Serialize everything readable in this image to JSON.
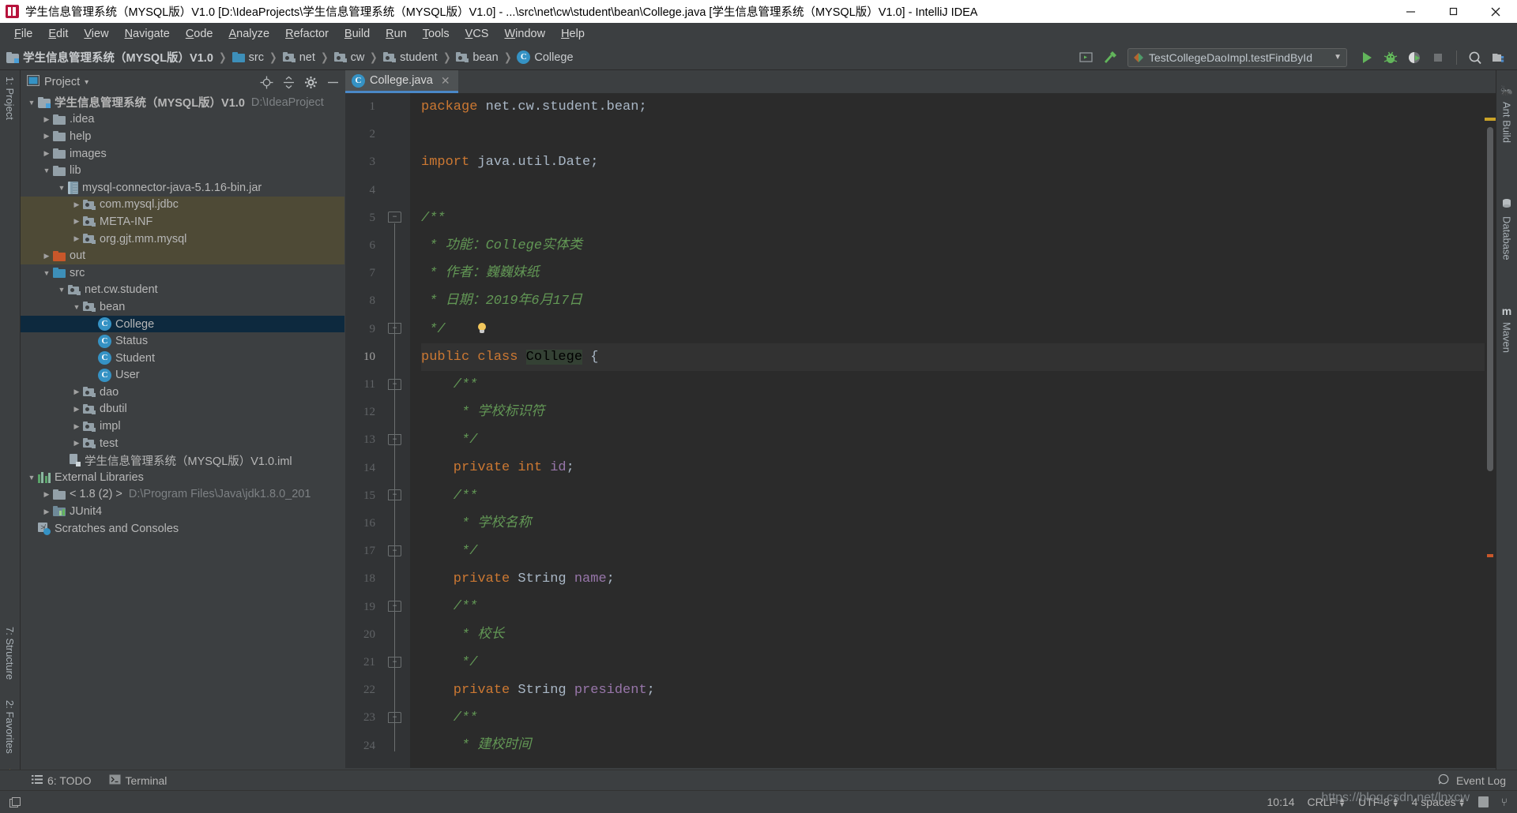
{
  "window": {
    "title": "学生信息管理系统（MYSQL版）V1.0 [D:\\IdeaProjects\\学生信息管理系统（MYSQL版）V1.0] - ...\\src\\net\\cw\\student\\bean\\College.java [学生信息管理系统（MYSQL版）V1.0] - IntelliJ IDEA",
    "minimize_label": "–",
    "maximize_label": "❐",
    "close_label": "✕"
  },
  "menubar": {
    "items": [
      {
        "label": "File"
      },
      {
        "label": "Edit"
      },
      {
        "label": "View"
      },
      {
        "label": "Navigate"
      },
      {
        "label": "Code"
      },
      {
        "label": "Analyze"
      },
      {
        "label": "Refactor"
      },
      {
        "label": "Build"
      },
      {
        "label": "Run"
      },
      {
        "label": "Tools"
      },
      {
        "label": "VCS"
      },
      {
        "label": "Window"
      },
      {
        "label": "Help"
      }
    ]
  },
  "navbar": {
    "breadcrumbs": [
      {
        "label": "学生信息管理系统（MYSQL版）V1.0",
        "icon": "project-folder-icon"
      },
      {
        "label": "src",
        "icon": "source-folder-icon"
      },
      {
        "label": "net",
        "icon": "package-icon"
      },
      {
        "label": "cw",
        "icon": "package-icon"
      },
      {
        "label": "student",
        "icon": "package-icon"
      },
      {
        "label": "bean",
        "icon": "package-icon"
      },
      {
        "label": "College",
        "icon": "class-icon"
      }
    ],
    "separator": "❯",
    "run_configuration": "TestCollegeDaoImpl.testFindById",
    "buttons": [
      {
        "name": "build-project-button",
        "icon": "hammer-icon"
      },
      {
        "name": "run-button",
        "icon": "play-icon"
      },
      {
        "name": "debug-button",
        "icon": "bug-icon"
      },
      {
        "name": "run-with-coverage-button",
        "icon": "coverage-icon"
      },
      {
        "name": "stop-button",
        "icon": "stop-icon"
      },
      {
        "name": "search-everywhere-button",
        "icon": "search-icon"
      },
      {
        "name": "project-structure-button",
        "icon": "project-structure-icon"
      }
    ]
  },
  "left_strip": {
    "tabs": [
      {
        "label": "1: Project"
      },
      {
        "label": "7: Structure"
      },
      {
        "label": "2: Favorites"
      }
    ]
  },
  "right_strip": {
    "tabs": [
      {
        "label": "Ant Build",
        "icon": "ant-icon"
      },
      {
        "label": "Database",
        "icon": "database-icon"
      },
      {
        "label": "Maven",
        "icon": "maven-icon"
      }
    ]
  },
  "project_panel": {
    "title": "Project",
    "dropdown_caret": "▾",
    "actions": [
      {
        "name": "locate-file-button",
        "icon": "crosshair-icon"
      },
      {
        "name": "collapse-all-button",
        "icon": "collapse-all-icon"
      },
      {
        "name": "settings-button",
        "icon": "gear-icon"
      },
      {
        "name": "hide-button",
        "icon": "minus-icon"
      }
    ],
    "tree": [
      {
        "indent": 0,
        "arrow": "▼",
        "icon": "project-folder-icon",
        "label": "学生信息管理系统（MYSQL版）V1.0",
        "bold": true,
        "dim": "D:\\IdeaProject",
        "state": "normal"
      },
      {
        "indent": 1,
        "arrow": "▶",
        "icon": "folder-gray-icon",
        "label": ".idea",
        "state": "normal"
      },
      {
        "indent": 1,
        "arrow": "▶",
        "icon": "folder-gray-icon",
        "label": "help",
        "state": "normal"
      },
      {
        "indent": 1,
        "arrow": "▶",
        "icon": "folder-gray-icon",
        "label": "images",
        "state": "normal"
      },
      {
        "indent": 1,
        "arrow": "▼",
        "icon": "folder-gray-icon",
        "label": "lib",
        "state": "normal"
      },
      {
        "indent": 2,
        "arrow": "▼",
        "icon": "jar-icon",
        "label": "mysql-connector-java-5.1.16-bin.jar",
        "state": "normal"
      },
      {
        "indent": 3,
        "arrow": "▶",
        "icon": "package-icon",
        "label": "com.mysql.jdbc",
        "state": "highlight"
      },
      {
        "indent": 3,
        "arrow": "▶",
        "icon": "package-icon",
        "label": "META-INF",
        "state": "highlight"
      },
      {
        "indent": 3,
        "arrow": "▶",
        "icon": "package-icon",
        "label": "org.gjt.mm.mysql",
        "state": "highlight"
      },
      {
        "indent": 1,
        "arrow": "▶",
        "icon": "folder-orange-icon",
        "label": "out",
        "state": "highlight"
      },
      {
        "indent": 1,
        "arrow": "▼",
        "icon": "folder-blue-icon",
        "label": "src",
        "state": "normal"
      },
      {
        "indent": 2,
        "arrow": "▼",
        "icon": "package-icon",
        "label": "net.cw.student",
        "state": "normal"
      },
      {
        "indent": 3,
        "arrow": "▼",
        "icon": "package-icon",
        "label": "bean",
        "state": "normal"
      },
      {
        "indent": 4,
        "arrow": "",
        "icon": "class-icon",
        "label": "College",
        "state": "selected"
      },
      {
        "indent": 4,
        "arrow": "",
        "icon": "class-icon",
        "label": "Status",
        "state": "normal"
      },
      {
        "indent": 4,
        "arrow": "",
        "icon": "class-icon",
        "label": "Student",
        "state": "normal"
      },
      {
        "indent": 4,
        "arrow": "",
        "icon": "class-icon",
        "label": "User",
        "state": "normal"
      },
      {
        "indent": 3,
        "arrow": "▶",
        "icon": "package-icon",
        "label": "dao",
        "state": "normal"
      },
      {
        "indent": 3,
        "arrow": "▶",
        "icon": "package-icon",
        "label": "dbutil",
        "state": "normal"
      },
      {
        "indent": 3,
        "arrow": "▶",
        "icon": "package-icon",
        "label": "impl",
        "state": "normal"
      },
      {
        "indent": 3,
        "arrow": "▶",
        "icon": "package-icon",
        "label": "test",
        "state": "normal"
      },
      {
        "indent": 2,
        "arrow": "",
        "icon": "iml-icon",
        "label": "学生信息管理系统（MYSQL版）V1.0.iml",
        "state": "normal"
      },
      {
        "indent": 0,
        "arrow": "▼",
        "icon": "library-icon",
        "label": "External Libraries",
        "state": "normal"
      },
      {
        "indent": 1,
        "arrow": "▶",
        "icon": "jdk-icon",
        "label": "< 1.8 (2) >",
        "dim": "D:\\Program Files\\Java\\jdk1.8.0_201",
        "state": "normal"
      },
      {
        "indent": 1,
        "arrow": "▶",
        "icon": "junit-icon",
        "label": "JUnit4",
        "state": "normal"
      },
      {
        "indent": 0,
        "arrow": "",
        "icon": "scratches-icon",
        "label": "Scratches and Consoles",
        "state": "normal"
      }
    ]
  },
  "editor": {
    "tab": {
      "label": "College.java",
      "icon": "class-icon",
      "close": "✕"
    },
    "breadcrumb": "College",
    "current_line": 10,
    "lines": [
      {
        "n": 1,
        "fold": "",
        "tokens": [
          {
            "t": "package",
            "c": "kw"
          },
          {
            "t": " net.cw.student.bean;",
            "c": "pln"
          }
        ]
      },
      {
        "n": 2,
        "fold": "",
        "tokens": []
      },
      {
        "n": 3,
        "fold": "",
        "tokens": [
          {
            "t": "import",
            "c": "kw"
          },
          {
            "t": " java.util.Date;",
            "c": "pln"
          }
        ]
      },
      {
        "n": 4,
        "fold": "",
        "tokens": []
      },
      {
        "n": 5,
        "fold": "open",
        "tokens": [
          {
            "t": "/**",
            "c": "cmt"
          }
        ]
      },
      {
        "n": 6,
        "fold": "",
        "tokens": [
          {
            "t": " * 功能：College实体类",
            "c": "cmt"
          }
        ]
      },
      {
        "n": 7,
        "fold": "",
        "tokens": [
          {
            "t": " * 作者：巍巍妹纸",
            "c": "cmt"
          }
        ]
      },
      {
        "n": 8,
        "fold": "",
        "tokens": [
          {
            "t": " * 日期：2019年6月17日",
            "c": "cmt"
          }
        ]
      },
      {
        "n": 9,
        "fold": "close",
        "bulb": true,
        "tokens": [
          {
            "t": " */",
            "c": "cmt"
          }
        ]
      },
      {
        "n": 10,
        "fold": "",
        "cur": true,
        "tokens": [
          {
            "t": "public class ",
            "c": "kw"
          },
          {
            "t": "College",
            "c": "hlt"
          },
          {
            "t": " {",
            "c": "pln"
          }
        ]
      },
      {
        "n": 11,
        "fold": "open",
        "tokens": [
          {
            "t": "    /**",
            "c": "cmt"
          }
        ]
      },
      {
        "n": 12,
        "fold": "",
        "tokens": [
          {
            "t": "     * 学校标识符",
            "c": "cmt"
          }
        ]
      },
      {
        "n": 13,
        "fold": "close",
        "tokens": [
          {
            "t": "     */",
            "c": "cmt"
          }
        ]
      },
      {
        "n": 14,
        "fold": "",
        "tokens": [
          {
            "t": "    private int ",
            "c": "kw"
          },
          {
            "t": "id",
            "c": "fld"
          },
          {
            "t": ";",
            "c": "pln"
          }
        ]
      },
      {
        "n": 15,
        "fold": "open",
        "tokens": [
          {
            "t": "    /**",
            "c": "cmt"
          }
        ]
      },
      {
        "n": 16,
        "fold": "",
        "tokens": [
          {
            "t": "     * 学校名称",
            "c": "cmt"
          }
        ]
      },
      {
        "n": 17,
        "fold": "close",
        "tokens": [
          {
            "t": "     */",
            "c": "cmt"
          }
        ]
      },
      {
        "n": 18,
        "fold": "",
        "tokens": [
          {
            "t": "    private ",
            "c": "kw"
          },
          {
            "t": "String ",
            "c": "cls"
          },
          {
            "t": "name",
            "c": "fld"
          },
          {
            "t": ";",
            "c": "pln"
          }
        ]
      },
      {
        "n": 19,
        "fold": "open",
        "tokens": [
          {
            "t": "    /**",
            "c": "cmt"
          }
        ]
      },
      {
        "n": 20,
        "fold": "",
        "tokens": [
          {
            "t": "     * 校长",
            "c": "cmt"
          }
        ]
      },
      {
        "n": 21,
        "fold": "close",
        "tokens": [
          {
            "t": "     */",
            "c": "cmt"
          }
        ]
      },
      {
        "n": 22,
        "fold": "",
        "tokens": [
          {
            "t": "    private ",
            "c": "kw"
          },
          {
            "t": "String ",
            "c": "cls"
          },
          {
            "t": "president",
            "c": "fld"
          },
          {
            "t": ";",
            "c": "pln"
          }
        ]
      },
      {
        "n": 23,
        "fold": "open",
        "tokens": [
          {
            "t": "    /**",
            "c": "cmt"
          }
        ]
      },
      {
        "n": 24,
        "fold": "",
        "tokens": [
          {
            "t": "     * 建校时间",
            "c": "cmt"
          }
        ]
      }
    ]
  },
  "bottom_bar": {
    "items": [
      {
        "label": "6: TODO",
        "key": "6",
        "icon": "todo-icon"
      },
      {
        "label": "Terminal",
        "icon": "terminal-icon"
      }
    ],
    "event_log": "Event Log"
  },
  "status_bar": {
    "line_column": "10:14",
    "line_separator": "CRLF",
    "encoding": "UTF-8",
    "indent": "4 spaces",
    "watermark": "https://blog.csdn.net/lnxcw"
  },
  "colors": {
    "accent": "#4a88c7",
    "selection": "#0d293e",
    "highlight": "#4e4a36",
    "editor_bg": "#2b2b2b",
    "panel_bg": "#3c3f41",
    "keyword": "#cc7832",
    "comment": "#629755",
    "field": "#9876aa",
    "plain": "#a9b7c6"
  }
}
